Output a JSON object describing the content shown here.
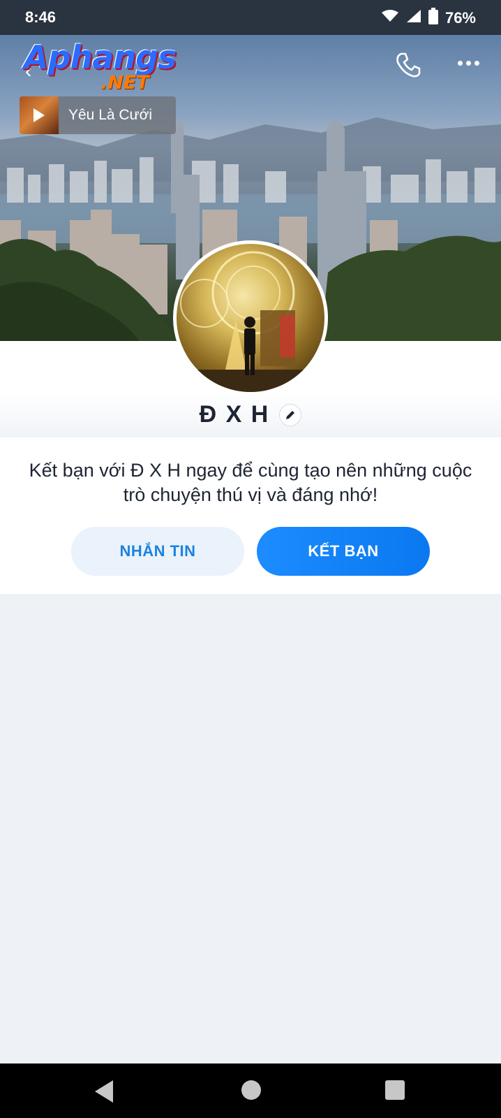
{
  "status_bar": {
    "time": "8:46",
    "battery_percent": "76%"
  },
  "header": {
    "logo_main": "Aphangs",
    "logo_sub": ".NET",
    "music_title": "Yêu Là Cưới",
    "phone_icon": "phone-icon",
    "more_icon": "more-options-icon"
  },
  "profile": {
    "name": "Đ X H"
  },
  "invite": {
    "message": "Kết bạn với Đ X H ngay để cùng tạo nên những cuộc trò chuyện thú vị và đáng nhớ!"
  },
  "actions": {
    "message_label": "NHẮN TIN",
    "add_friend_label": "KẾT BẠN"
  },
  "colors": {
    "primary": "#0a78f0",
    "secondary_bg": "#eaf2fb",
    "page_bg": "#eef2f6"
  }
}
